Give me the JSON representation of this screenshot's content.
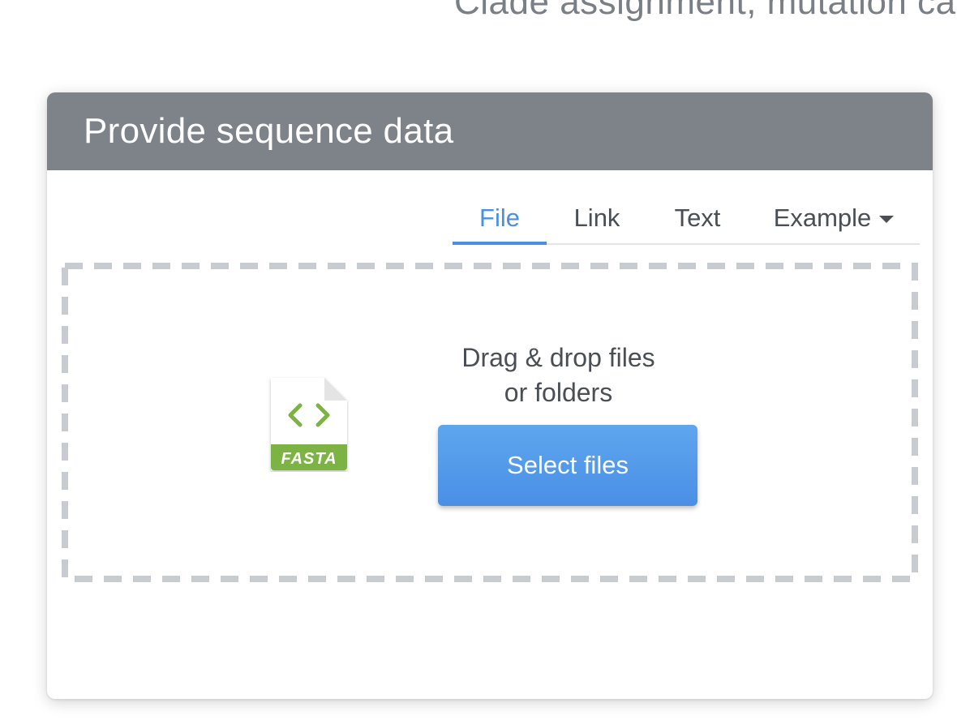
{
  "header": {
    "subtitle": "Clade assignment, mutation ca"
  },
  "card": {
    "title": "Provide sequence data"
  },
  "tabs": [
    {
      "label": "File",
      "active": true
    },
    {
      "label": "Link",
      "active": false
    },
    {
      "label": "Text",
      "active": false
    },
    {
      "label": "Example",
      "active": false
    }
  ],
  "dropzone": {
    "line1": "Drag & drop files",
    "line2": "or folders",
    "icon_label": "FASTA",
    "icon": "fasta-file-icon",
    "button_label": "Select files"
  },
  "colors": {
    "header_bg": "#7d8389",
    "accent": "#4a90e2",
    "fasta_green": "#7cb342",
    "dash": "#c8cbcf"
  }
}
